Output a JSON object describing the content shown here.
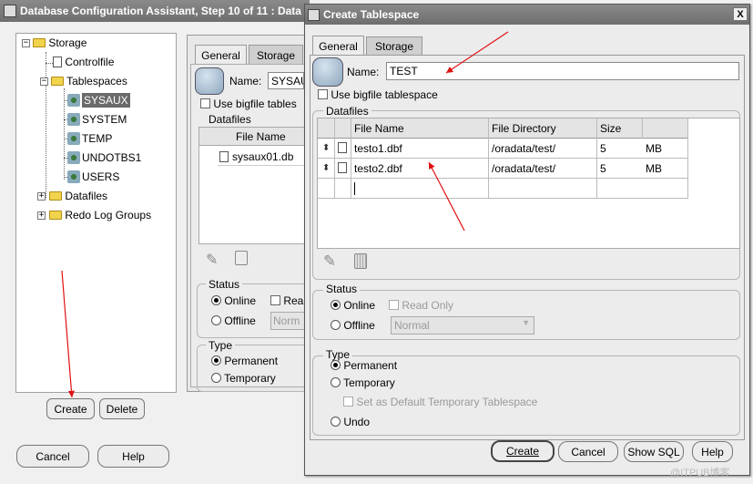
{
  "bg_window": {
    "title": "Database Configuration Assistant, Step 10 of 11 : Data",
    "tree": {
      "root": "Storage",
      "items": [
        "Controlfile",
        "Tablespaces"
      ],
      "tablespaces": [
        "SYSAUX",
        "SYSTEM",
        "TEMP",
        "UNDOTBS1",
        "USERS"
      ],
      "tail": [
        "Datafiles",
        "Redo Log Groups"
      ]
    },
    "create_label": "Create",
    "delete_label": "Delete",
    "cancel_label": "Cancel",
    "help_label": "Help",
    "tabs": [
      "General",
      "Storage"
    ],
    "name_label": "Name:",
    "name_value": "SYSAU",
    "bigfile_label": "Use bigfile tables",
    "datafiles_label": "Datafiles",
    "file_name_header": "File Name",
    "file_row": "sysaux01.db",
    "status_label": "Status",
    "online_label": "Online",
    "readonly_label": "Rea",
    "offline_label": "Offline",
    "offline_value": "Norm",
    "type_label": "Type",
    "permanent_label": "Permanent",
    "temporary_label": "Temporary"
  },
  "dialog": {
    "title": "Create Tablespace",
    "close_glyph": "X",
    "tabs": [
      "General",
      "Storage"
    ],
    "name_label": "Name:",
    "name_value": "TEST",
    "bigfile_label": "Use bigfile tablespace",
    "datafiles_label": "Datafiles",
    "columns": [
      "File Name",
      "File Directory",
      "Size"
    ],
    "rows": [
      {
        "file": "testo1.dbf",
        "dir": "/oradata/test/",
        "size": "5",
        "unit": "MB"
      },
      {
        "file": "testo2.dbf",
        "dir": "/oradata/test/",
        "size": "5",
        "unit": "MB"
      }
    ],
    "status_label": "Status",
    "online_label": "Online",
    "readonly_label": "Read Only",
    "offline_label": "Offline",
    "offline_value": "Normal",
    "type_label": "Type",
    "permanent_label": "Permanent",
    "temporary_label": "Temporary",
    "default_temp_label": "Set as Default Temporary Tablespace",
    "undo_label": "Undo",
    "create_label": "Create",
    "cancel_label": "Cancel",
    "showsql_label": "Show SQL",
    "help_label": "Help"
  },
  "watermark": "@ITPUB博客",
  "colors": {
    "accent_arrow": "#e01010",
    "titlebar": "#7a7a7a",
    "selected": "#6a6a6a"
  }
}
